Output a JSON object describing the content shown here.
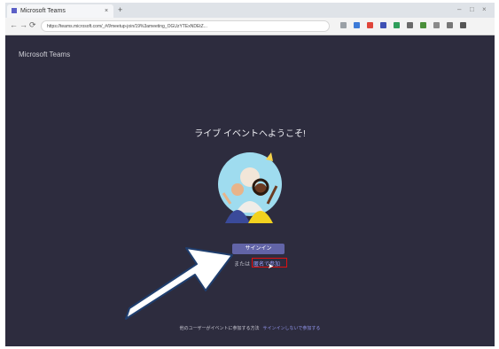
{
  "browser": {
    "tab_title": "Microsoft Teams",
    "tab_close": "×",
    "new_tab": "+",
    "window_controls": [
      "–",
      "□",
      "×"
    ],
    "nav": {
      "back": "←",
      "forward": "→",
      "refresh": "⟳"
    },
    "url": "https://teams.microsoft.com/_#/l/meetup-join/19%3ameeting_OGUzYTExNDEtZ..."
  },
  "page": {
    "brand": "Microsoft Teams",
    "welcome": "ライブ イベントへようこそ!",
    "signin_button": "サインイン",
    "alt_prefix": "または",
    "anonymous_link": "匿名で参加",
    "footer_text": "他のユーザーがイベントに参加する方法",
    "footer_link": "サインインしないで参加する"
  },
  "colors": {
    "background": "#2d2c3e",
    "brand_purple": "#6264a7",
    "highlight_red": "#e01010",
    "arrow_fill": "#ffffff",
    "arrow_stroke": "#1f3e6e"
  }
}
